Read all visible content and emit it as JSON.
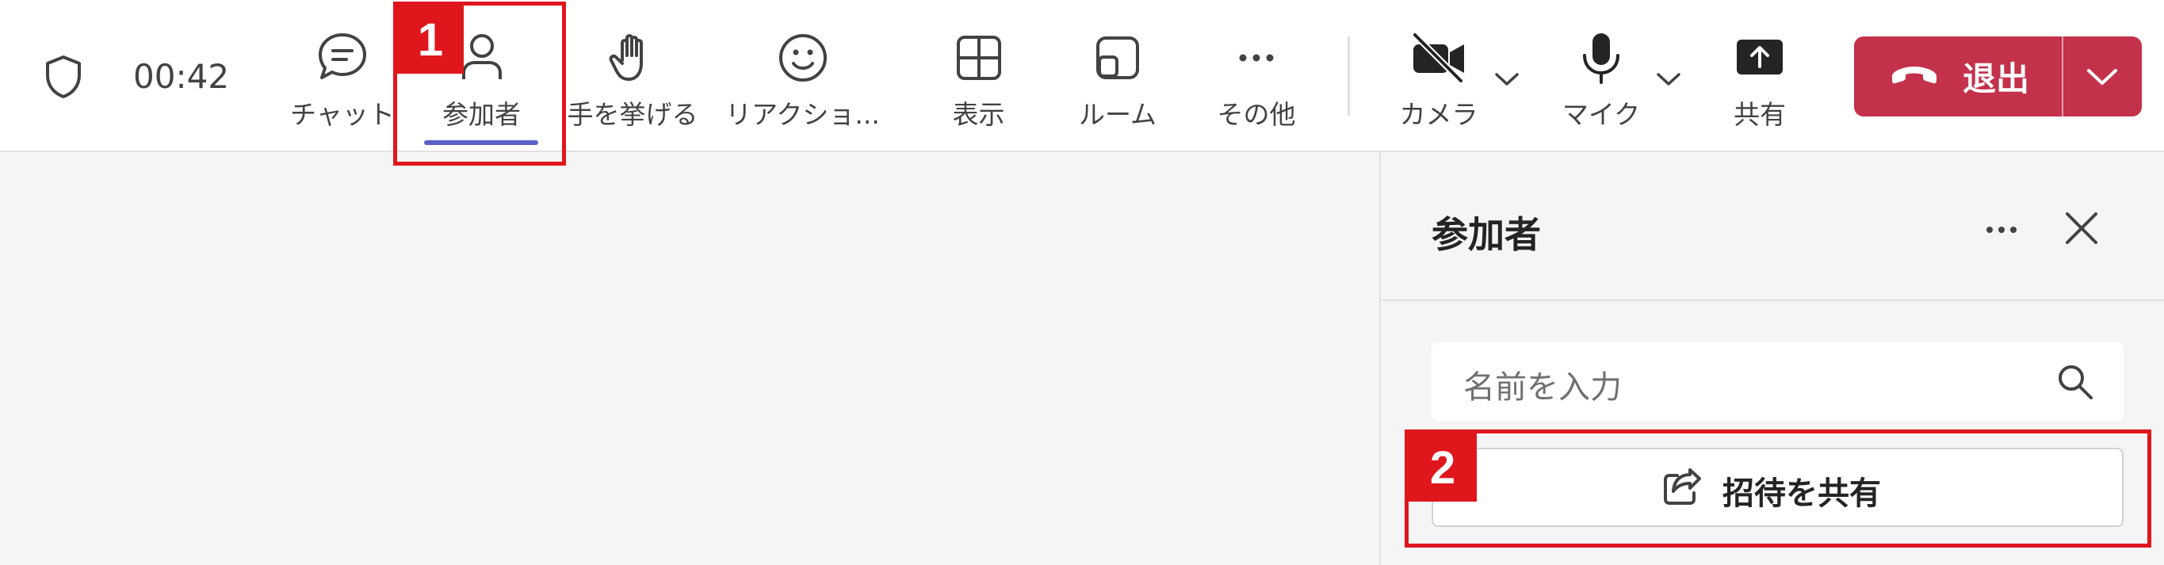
{
  "toolbar": {
    "timer": "00:42",
    "chat_label": "チャット",
    "participants_label": "参加者",
    "raise_hand_label": "手を挙げる",
    "reactions_label": "リアクショ...",
    "view_label": "表示",
    "rooms_label": "ルーム",
    "more_label": "その他",
    "camera_label": "カメラ",
    "mic_label": "マイク",
    "share_label": "共有",
    "leave_label": "退出"
  },
  "panel": {
    "title": "参加者",
    "search_placeholder": "名前を入力",
    "invite_label": "招待を共有"
  },
  "annotations": {
    "step1": "1",
    "step2": "2"
  },
  "colors": {
    "leave_button": "#c4314b",
    "active_indicator": "#5b5fc7",
    "annotation_red": "#e0161d"
  }
}
